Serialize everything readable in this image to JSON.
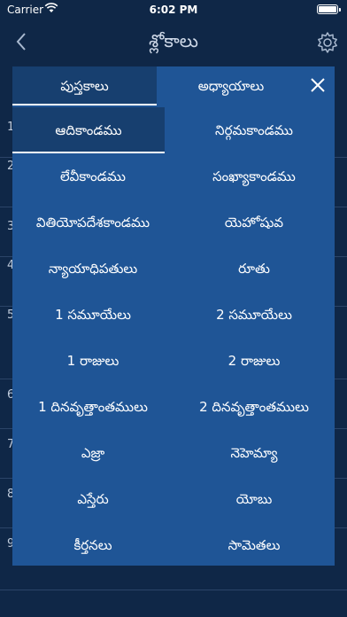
{
  "status": {
    "carrier": "Carrier",
    "time": "6:02 PM"
  },
  "nav": {
    "title": "శ్లోకాలు"
  },
  "background": {
    "row_numbers": [
      "1",
      "2",
      "3",
      "4",
      "5",
      "6",
      "7",
      "8",
      "9"
    ]
  },
  "modal": {
    "tabs": [
      "పుస్తకాలు",
      "అధ్యాయాలు"
    ],
    "books": [
      "ఆదికాండము",
      "నిర్గమకాండము",
      "లేవీకాండము",
      "సంఖ్యాకాండము",
      "వితియోపదేశకాండము",
      "యెహోషువ",
      "న్యాయాధిపతులు",
      "రూతు",
      "1 సమూయేలు",
      "2 సమూయేలు",
      "1 రాజులు",
      "2 రాజులు",
      "1 దినవృత్తాంతములు",
      "2 దినవృత్తాంతములు",
      "ఎజ్రా",
      "నెహెమ్యా",
      "ఎస్తేరు",
      "యోబు",
      "కీర్తనలు",
      "సామెతలు"
    ]
  },
  "icons": {
    "back": "chevron-left-icon",
    "settings": "gear-icon",
    "close": "close-icon",
    "wifi": "wifi-icon",
    "battery": "battery-icon"
  }
}
